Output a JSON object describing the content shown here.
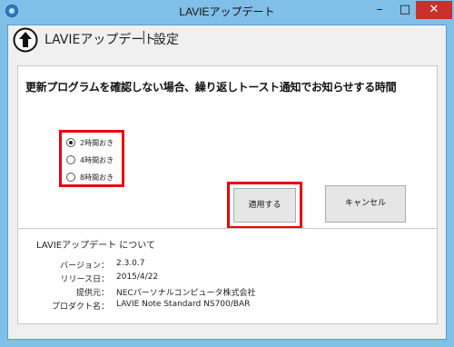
{
  "window": {
    "title": "LAVIEアップデート",
    "controls": {
      "minimize": "–",
      "maximize": "□",
      "close": "✕"
    },
    "titlebar_color": "#80bfe8",
    "close_color": "#c7302b"
  },
  "header": {
    "icon": "up-arrow-circle-icon",
    "title": "LAVIEアップデート",
    "separator": "|",
    "subtitle": "設定"
  },
  "settings": {
    "heading": "更新プログラムを確認しない場合、繰り返しトースト通知でお知らせする時間",
    "options": [
      {
        "label": "2時間おき",
        "checked": true
      },
      {
        "label": "4時間おき",
        "checked": false
      },
      {
        "label": "8時間おき",
        "checked": false
      }
    ],
    "apply_label": "適用する",
    "cancel_label": "キャンセル",
    "highlight_color": "#e8000b"
  },
  "about": {
    "title": "LAVIEアップデート について",
    "rows": [
      {
        "label": "バージョン：",
        "value": "2.3.0.7"
      },
      {
        "label": "リリース日：",
        "value": "2015/4/22"
      },
      {
        "label": "提供元：",
        "value": "NECパーソナルコンピュータ株式会社"
      },
      {
        "label": "プロダクト名：",
        "value": "LAVIE Note Standard NS700/BAR"
      }
    ]
  }
}
